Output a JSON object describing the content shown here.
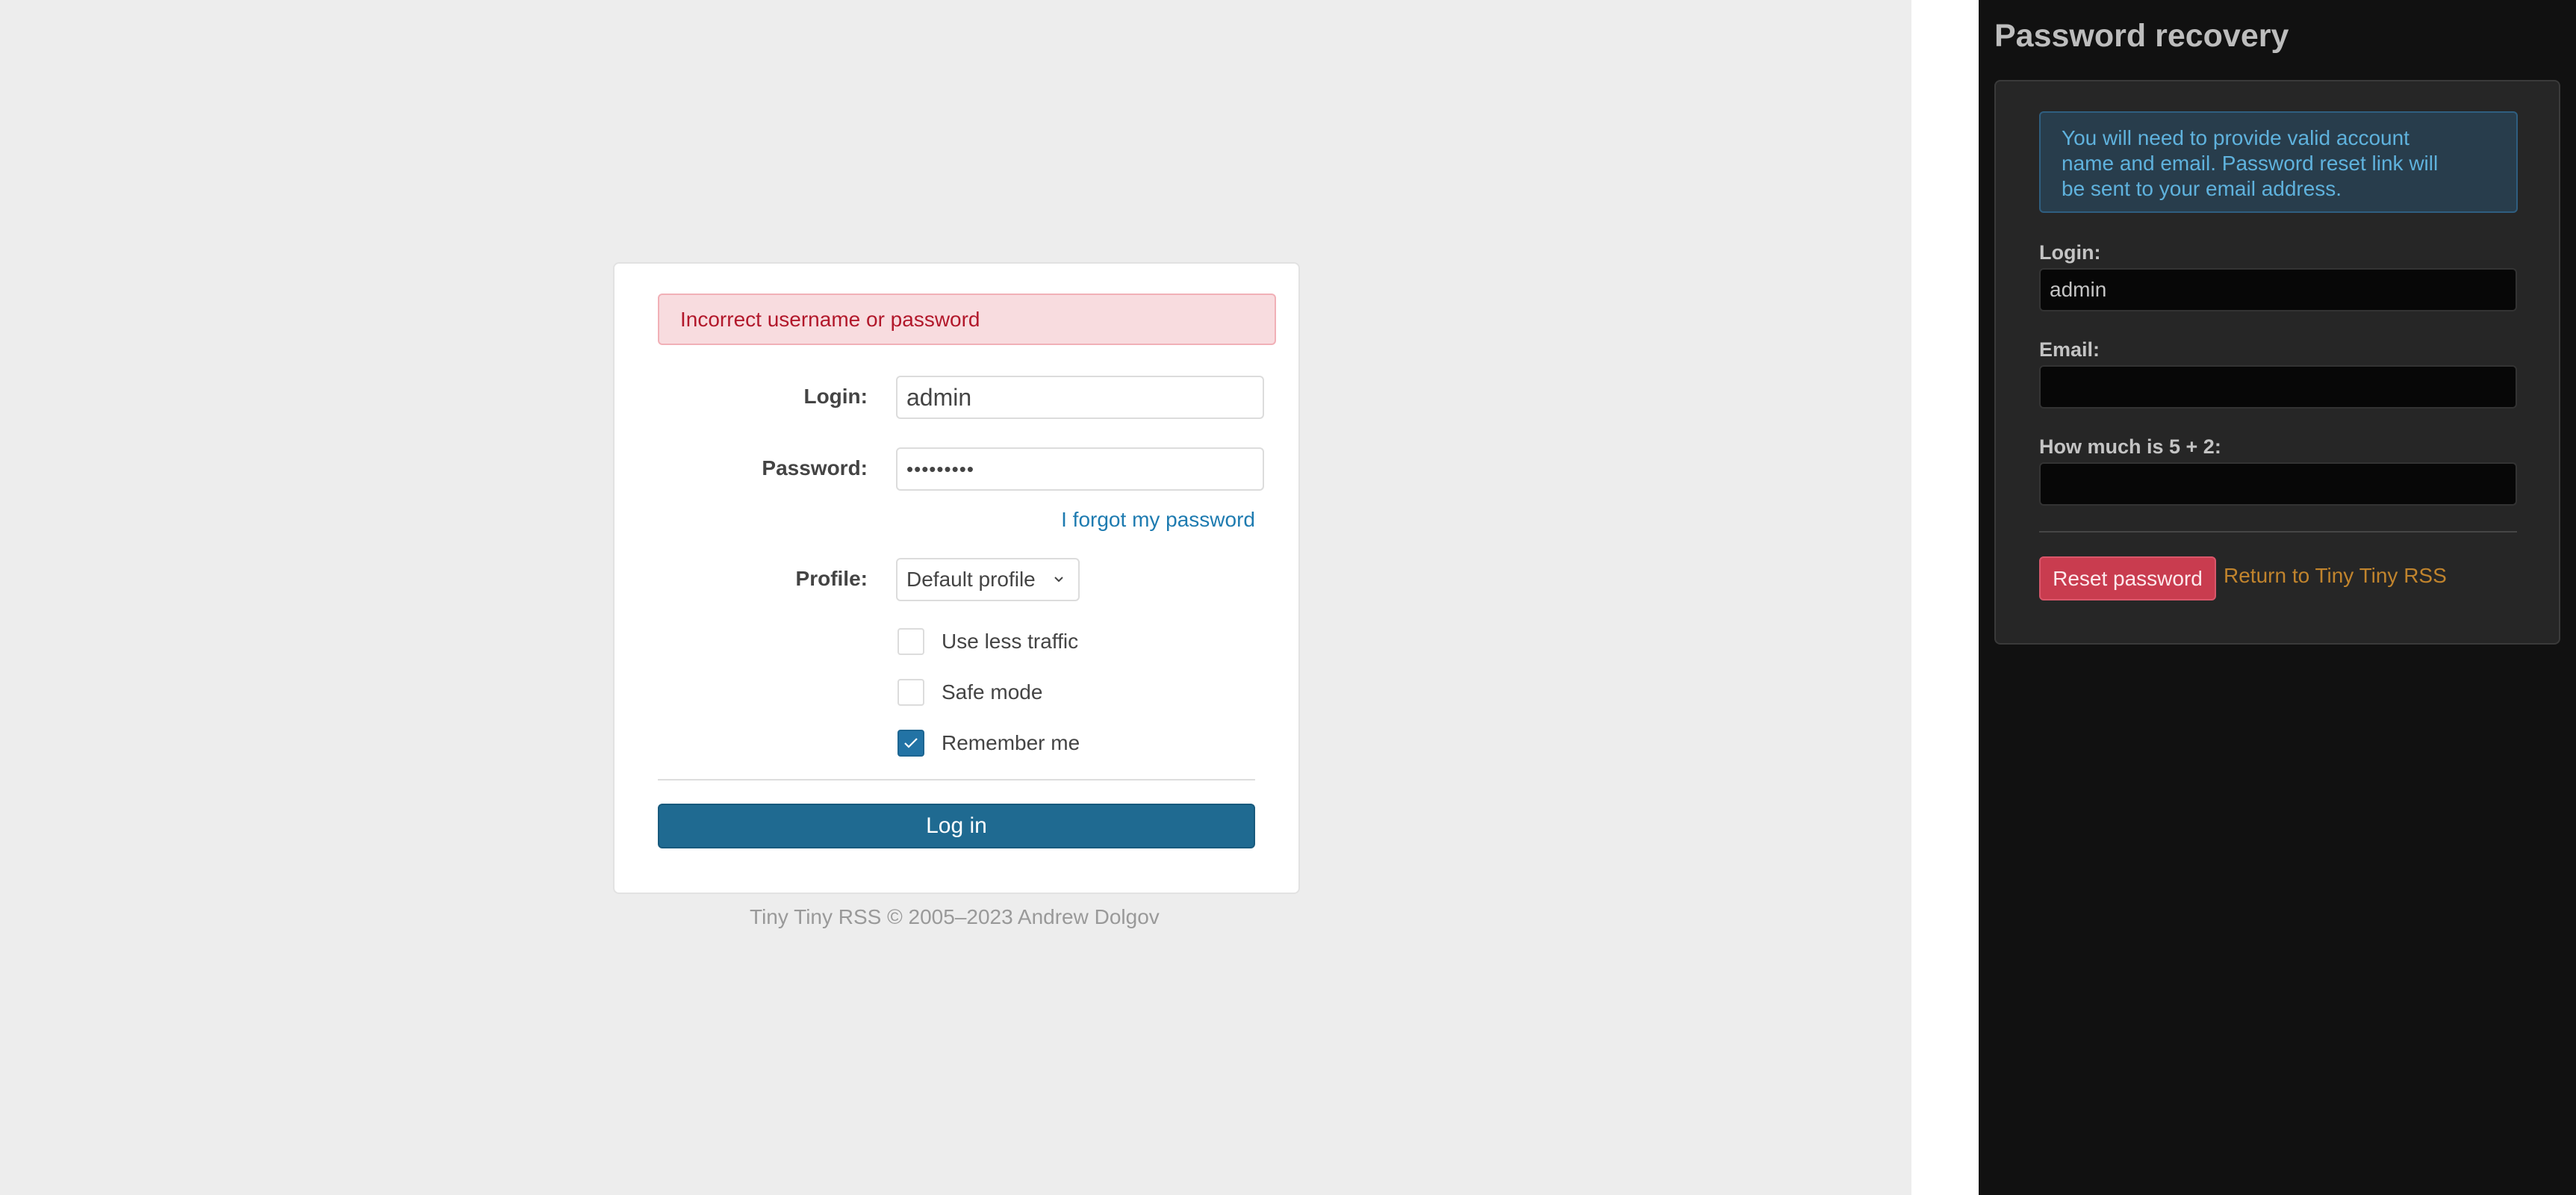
{
  "login": {
    "error_message": "Incorrect username or password",
    "login_label": "Login:",
    "login_value": "admin",
    "password_label": "Password:",
    "password_value": "•••••••••",
    "forgot_link": "I forgot my password",
    "profile_label": "Profile:",
    "profile_selected": "Default profile",
    "checkboxes": [
      {
        "label": "Use less traffic",
        "checked": false
      },
      {
        "label": "Safe mode",
        "checked": false
      },
      {
        "label": "Remember me",
        "checked": true
      }
    ],
    "login_button": "Log in",
    "footer": "Tiny Tiny RSS © 2005–2023 Andrew Dolgov"
  },
  "recovery": {
    "title": "Password recovery",
    "info": "You will need to provide valid account name and email. Password reset link will be sent to your email address.",
    "login_label": "Login:",
    "login_value": "admin",
    "email_label": "Email:",
    "email_value": "",
    "captcha_label": "How much is 5 + 2:",
    "captcha_value": "",
    "reset_button": "Reset password",
    "return_link": "Return to Tiny Tiny RSS"
  },
  "colors": {
    "primary": "#1f6a91",
    "link": "#1e7bb0",
    "error_text": "#b2182b",
    "error_bg": "#f8dcdf",
    "danger_button": "#c93c4f",
    "return_link": "#c1842d",
    "info_text": "#5fb2dd"
  }
}
